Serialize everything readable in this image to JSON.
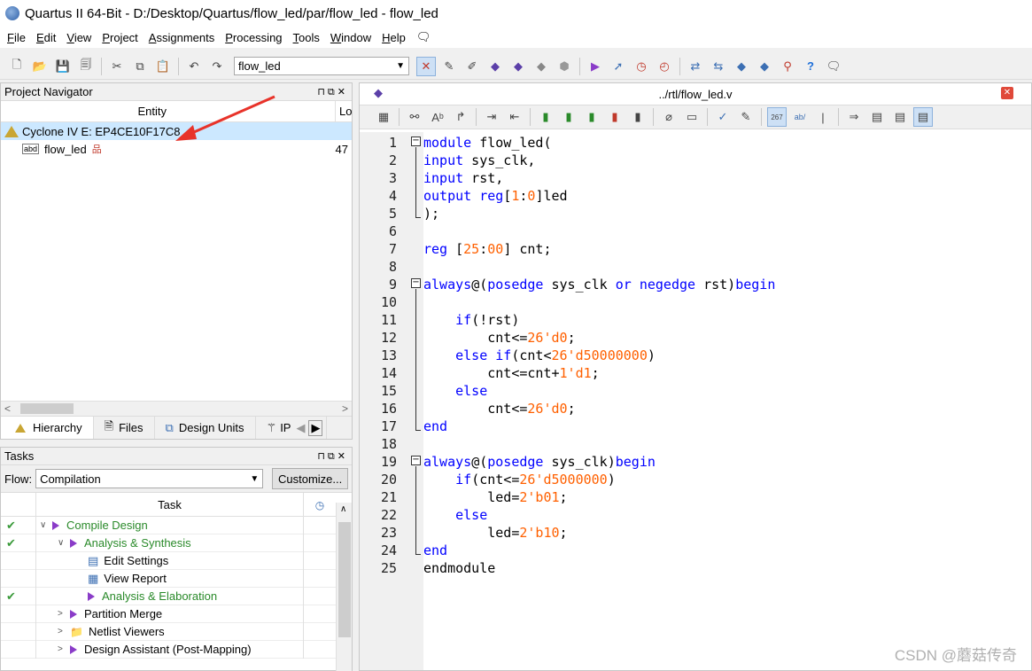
{
  "window": {
    "title": "Quartus II 64-Bit - D:/Desktop/Quartus/flow_led/par/flow_led - flow_led"
  },
  "menu": [
    {
      "label": "File",
      "hot": "F",
      "rest": "ile"
    },
    {
      "label": "Edit",
      "hot": "E",
      "rest": "dit"
    },
    {
      "label": "View",
      "hot": "V",
      "rest": "iew"
    },
    {
      "label": "Project",
      "hot": "P",
      "rest": "roject"
    },
    {
      "label": "Assignments",
      "hot": "A",
      "rest": "ssignments"
    },
    {
      "label": "Processing",
      "hot": "P",
      "rest": "rocessing"
    },
    {
      "label": "Tools",
      "hot": "T",
      "rest": "ools"
    },
    {
      "label": "Window",
      "hot": "W",
      "rest": "indow"
    },
    {
      "label": "Help",
      "hot": "H",
      "rest": "elp"
    }
  ],
  "toolbar": {
    "entity_combo": "flow_led"
  },
  "navigator": {
    "title": "Project Navigator",
    "col_entity": "Entity",
    "col_lo": "Lo",
    "device": "Cyclone IV E: EP4CE10F17C8",
    "entity": "flow_led",
    "entity_lo": "47",
    "tabs": [
      "Hierarchy",
      "Files",
      "Design Units",
      "IP"
    ]
  },
  "tasks": {
    "title": "Tasks",
    "flow_label": "Flow:",
    "flow_value": "Compilation",
    "customize": "Customize...",
    "col_task": "Task",
    "rows": [
      {
        "label": "Compile Design",
        "checked": true,
        "chev": "∨",
        "indent": 0,
        "green": true,
        "icon": "play"
      },
      {
        "label": "Analysis & Synthesis",
        "checked": true,
        "chev": "∨",
        "indent": 1,
        "green": true,
        "icon": "play"
      },
      {
        "label": "Edit Settings",
        "checked": false,
        "chev": "",
        "indent": 2,
        "green": false,
        "icon": "settings"
      },
      {
        "label": "View Report",
        "checked": false,
        "chev": "",
        "indent": 2,
        "green": false,
        "icon": "report"
      },
      {
        "label": "Analysis & Elaboration",
        "checked": true,
        "chev": "",
        "indent": 2,
        "green": true,
        "icon": "play"
      },
      {
        "label": "Partition Merge",
        "checked": false,
        "chev": ">",
        "indent": 1,
        "green": false,
        "icon": "play"
      },
      {
        "label": "Netlist Viewers",
        "checked": false,
        "chev": ">",
        "indent": 1,
        "green": false,
        "icon": "folder"
      },
      {
        "label": "Design Assistant (Post-Mapping)",
        "checked": false,
        "chev": ">",
        "indent": 1,
        "green": false,
        "icon": "play"
      }
    ]
  },
  "editor": {
    "title": "../rtl/flow_led.v",
    "line_numbers": [
      "1",
      "2",
      "3",
      "4",
      "5",
      "6",
      "7",
      "8",
      "9",
      "10",
      "11",
      "12",
      "13",
      "14",
      "15",
      "16",
      "17",
      "18",
      "19",
      "20",
      "21",
      "22",
      "23",
      "24",
      "25"
    ],
    "lines": [
      [
        [
          "k",
          "module"
        ],
        [
          "t",
          " flow_led("
        ]
      ],
      [
        [
          "k",
          "input"
        ],
        [
          "t",
          " sys_clk,"
        ]
      ],
      [
        [
          "k",
          "input"
        ],
        [
          "t",
          " rst,"
        ]
      ],
      [
        [
          "k",
          "output"
        ],
        [
          "t",
          " "
        ],
        [
          "k",
          "reg"
        ],
        [
          "t",
          "["
        ],
        [
          "n",
          "1"
        ],
        [
          "t",
          ":"
        ],
        [
          "n",
          "0"
        ],
        [
          "t",
          "]led"
        ]
      ],
      [
        [
          "t",
          ");"
        ]
      ],
      [
        [
          "t",
          ""
        ]
      ],
      [
        [
          "k",
          "reg"
        ],
        [
          "t",
          " ["
        ],
        [
          "n",
          "25"
        ],
        [
          "t",
          ":"
        ],
        [
          "n",
          "00"
        ],
        [
          "t",
          "] cnt;"
        ]
      ],
      [
        [
          "t",
          ""
        ]
      ],
      [
        [
          "k",
          "always"
        ],
        [
          "t",
          "@("
        ],
        [
          "k",
          "posedge"
        ],
        [
          "t",
          " sys_clk "
        ],
        [
          "k",
          "or"
        ],
        [
          "t",
          " "
        ],
        [
          "k",
          "negedge"
        ],
        [
          "t",
          " rst)"
        ],
        [
          "k",
          "begin"
        ]
      ],
      [
        [
          "t",
          ""
        ]
      ],
      [
        [
          "t",
          "    "
        ],
        [
          "k",
          "if"
        ],
        [
          "t",
          "(!rst)"
        ]
      ],
      [
        [
          "t",
          "        cnt<="
        ],
        [
          "n",
          "26'd0"
        ],
        [
          "t",
          ";"
        ]
      ],
      [
        [
          "t",
          "    "
        ],
        [
          "k",
          "else"
        ],
        [
          "t",
          " "
        ],
        [
          "k",
          "if"
        ],
        [
          "t",
          "(cnt<"
        ],
        [
          "n",
          "26'd50000000"
        ],
        [
          "t",
          ")"
        ]
      ],
      [
        [
          "t",
          "        cnt<=cnt+"
        ],
        [
          "n",
          "1'd1"
        ],
        [
          "t",
          ";"
        ]
      ],
      [
        [
          "t",
          "    "
        ],
        [
          "k",
          "else"
        ]
      ],
      [
        [
          "t",
          "        cnt<="
        ],
        [
          "n",
          "26'd0"
        ],
        [
          "t",
          ";"
        ]
      ],
      [
        [
          "k",
          "end"
        ]
      ],
      [
        [
          "t",
          ""
        ]
      ],
      [
        [
          "k",
          "always"
        ],
        [
          "t",
          "@("
        ],
        [
          "k",
          "posedge"
        ],
        [
          "t",
          " sys_clk)"
        ],
        [
          "k",
          "begin"
        ]
      ],
      [
        [
          "t",
          "    "
        ],
        [
          "k",
          "if"
        ],
        [
          "t",
          "(cnt<="
        ],
        [
          "n",
          "26'd5000000"
        ],
        [
          "t",
          ")"
        ]
      ],
      [
        [
          "t",
          "        led="
        ],
        [
          "n",
          "2'b01"
        ],
        [
          "t",
          ";"
        ]
      ],
      [
        [
          "t",
          "    "
        ],
        [
          "k",
          "else"
        ]
      ],
      [
        [
          "t",
          "        led="
        ],
        [
          "n",
          "2'b10"
        ],
        [
          "t",
          ";"
        ]
      ],
      [
        [
          "k",
          "end"
        ]
      ],
      [
        [
          "t",
          "endmodule"
        ]
      ]
    ]
  },
  "watermark": "CSDN @蘑菇传奇",
  "colors": {
    "keyword": "#0000ff",
    "number": "#ff6000",
    "done": "#2a8a2a",
    "arrow": "#e8332a"
  }
}
